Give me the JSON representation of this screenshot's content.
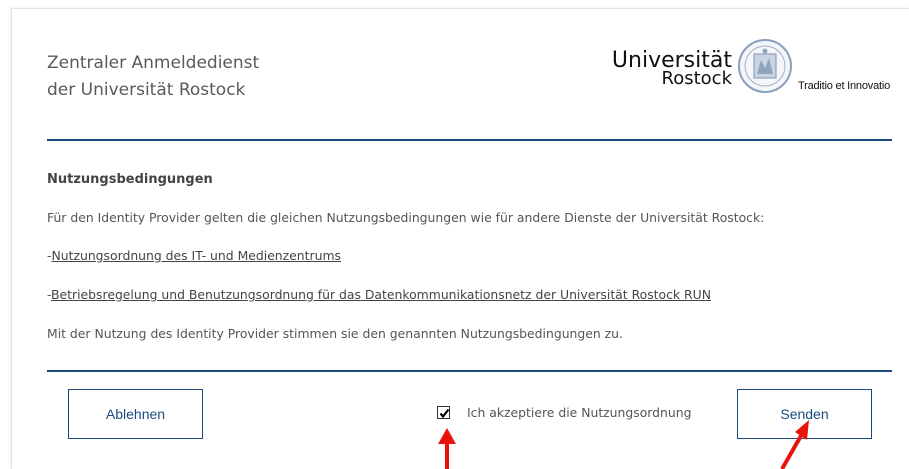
{
  "header": {
    "title_line1": "Zentraler Anmeldedienst",
    "title_line2": "der Universität Rostock"
  },
  "logo": {
    "name_line1": "Universität",
    "name_line2": "Rostock",
    "motto": "Traditio et Innovatio",
    "seal_icon": "university-seal-icon"
  },
  "terms": {
    "heading": "Nutzungsbedingungen",
    "intro": "Für den Identity Provider gelten die gleichen Nutzungsbedingungen wie für andere Dienste der Universität Rostock:",
    "link1_prefix": "-",
    "link1_text": "Nutzungsordnung des IT- und Medienzentrums",
    "link2_prefix": "-",
    "link2_text": "Betriebsregelung und Benutzungsordnung für das Datenkommunikationsnetz der Universität Rostock RUN",
    "footer_note": "Mit der Nutzung des Identity Provider stimmen sie den genannten Nutzungsbedingungen zu."
  },
  "actions": {
    "decline_label": "Ablehnen",
    "accept_label": "Ich akzeptiere die Nutzungsordnung",
    "accept_checked": true,
    "send_label": "Senden"
  },
  "colors": {
    "accent": "#1b4b7e",
    "annotation_arrow": "#e8140c"
  }
}
